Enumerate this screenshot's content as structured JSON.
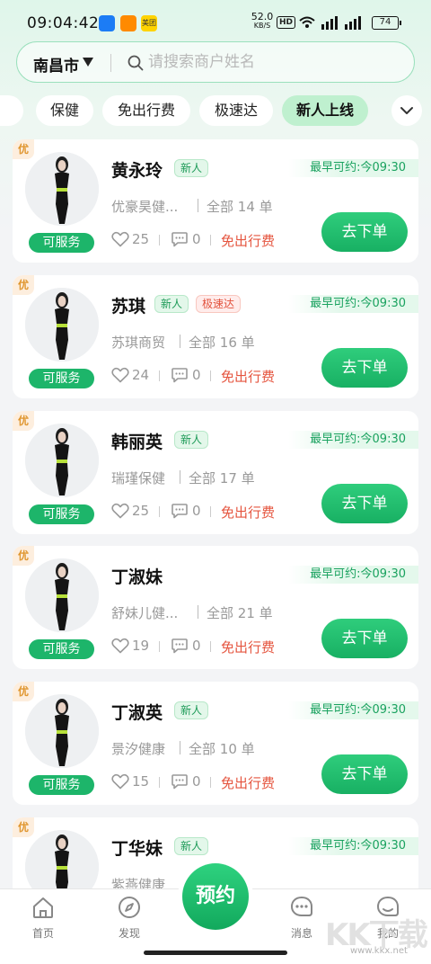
{
  "status_bar": {
    "time": "09:04:42",
    "network_speed": "52.0",
    "network_unit": "KB/S",
    "hd": "HD",
    "app3": "美团",
    "battery": "74"
  },
  "search": {
    "city": "南昌市",
    "placeholder": "请搜索商户姓名"
  },
  "tabs": [
    "保健",
    "免出行费",
    "极速达",
    "新人上线"
  ],
  "active_tab": "新人上线",
  "cards": [
    {
      "badge": "优",
      "name": "黄永玲",
      "tags": [
        "新人"
      ],
      "earliest": "最早可约:今09:30",
      "shop": "优豪昊健...",
      "orders_label": "全部",
      "orders_count": "14",
      "orders_unit": "单",
      "likes": "25",
      "comments": "0",
      "fee": "免出行费",
      "status": "可服务",
      "action": "去下单"
    },
    {
      "badge": "优",
      "name": "苏琪",
      "tags": [
        "新人",
        "极速达"
      ],
      "earliest": "最早可约:今09:30",
      "shop": "苏琪商贸",
      "orders_label": "全部",
      "orders_count": "16",
      "orders_unit": "单",
      "likes": "24",
      "comments": "0",
      "fee": "免出行费",
      "status": "可服务",
      "action": "去下单"
    },
    {
      "badge": "优",
      "name": "韩丽英",
      "tags": [
        "新人"
      ],
      "earliest": "最早可约:今09:30",
      "shop": "瑞瑾保健",
      "orders_label": "全部",
      "orders_count": "17",
      "orders_unit": "单",
      "likes": "25",
      "comments": "0",
      "fee": "免出行费",
      "status": "可服务",
      "action": "去下单"
    },
    {
      "badge": "优",
      "name": "丁淑妹",
      "tags": [],
      "earliest": "最早可约:今09:30",
      "shop": "舒妹儿健...",
      "orders_label": "全部",
      "orders_count": "21",
      "orders_unit": "单",
      "likes": "19",
      "comments": "0",
      "fee": "免出行费",
      "status": "可服务",
      "action": "去下单"
    },
    {
      "badge": "优",
      "name": "丁淑英",
      "tags": [
        "新人"
      ],
      "earliest": "最早可约:今09:30",
      "shop": "景汐健康",
      "orders_label": "全部",
      "orders_count": "10",
      "orders_unit": "单",
      "likes": "15",
      "comments": "0",
      "fee": "免出行费",
      "status": "可服务",
      "action": "去下单"
    },
    {
      "badge": "优",
      "name": "丁华妹",
      "tags": [
        "新人"
      ],
      "earliest": "最早可约:今09:30",
      "shop": "紫燕健康",
      "orders_label": "",
      "orders_count": "",
      "orders_unit": "",
      "likes": "",
      "comments": "",
      "fee": "",
      "status": "",
      "action": ""
    }
  ],
  "bottom_nav": {
    "home": "首页",
    "discover": "发现",
    "book": "预约",
    "messages": "消息",
    "mine": "我的"
  },
  "watermark": {
    "text": "KK下载",
    "url": "www.kkx.net"
  },
  "colors": {
    "accent": "#1db56a",
    "fee": "#e5553f",
    "tag_new": "#1c9a57",
    "tag_fast": "#e2513c"
  }
}
